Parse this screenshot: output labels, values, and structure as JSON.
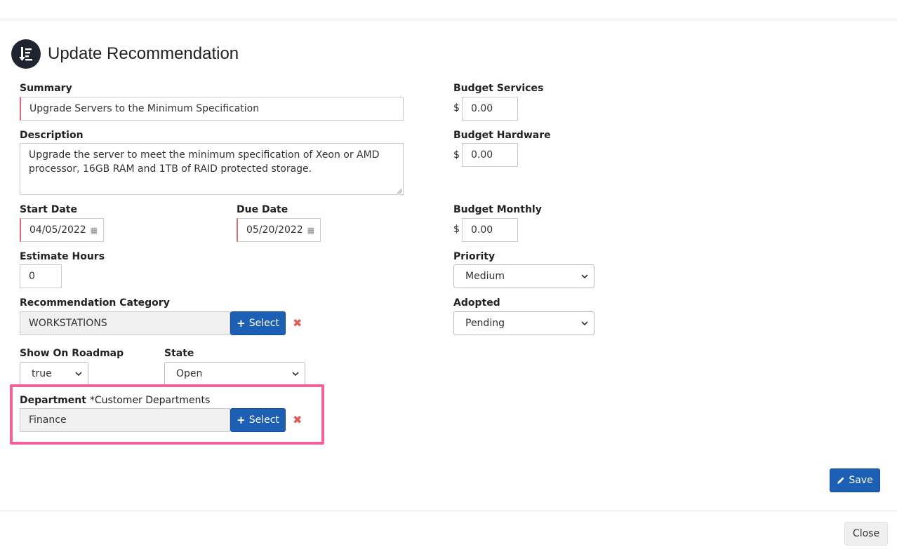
{
  "header": {
    "title": "Update Recommendation",
    "icon": "list-sort-icon"
  },
  "form": {
    "summary": {
      "label": "Summary",
      "value": "Upgrade Servers to the Minimum Specification"
    },
    "description": {
      "label": "Description",
      "value": "Upgrade the server to meet the minimum specification of Xeon or AMD processor, 16GB RAM and 1TB of RAID protected storage."
    },
    "start_date": {
      "label": "Start Date",
      "value": "04/05/2022"
    },
    "due_date": {
      "label": "Due Date",
      "value": "05/20/2022"
    },
    "estimate_hours": {
      "label": "Estimate Hours",
      "value": "0"
    },
    "recommendation_category": {
      "label": "Recommendation Category",
      "value": "WORKSTATIONS",
      "select_label": "Select"
    },
    "show_on_roadmap": {
      "label": "Show On Roadmap",
      "value": "true"
    },
    "state": {
      "label": "State",
      "value": "Open"
    },
    "department": {
      "label": "Department",
      "note": "*Customer Departments",
      "value": "Finance",
      "select_label": "Select"
    },
    "budget_services": {
      "label": "Budget Services",
      "currency": "$",
      "value": "0.00"
    },
    "budget_hardware": {
      "label": "Budget Hardware",
      "currency": "$",
      "value": "0.00"
    },
    "budget_monthly": {
      "label": "Budget Monthly",
      "currency": "$",
      "value": "0.00"
    },
    "priority": {
      "label": "Priority",
      "value": "Medium"
    },
    "adopted": {
      "label": "Adopted",
      "value": "Pending"
    }
  },
  "actions": {
    "save_label": "Save",
    "close_label": "Close"
  },
  "colors": {
    "primary": "#1d5fb4",
    "required_marker": "#e06c75",
    "highlight": "#f0629a",
    "remove": "#e05a5a"
  }
}
